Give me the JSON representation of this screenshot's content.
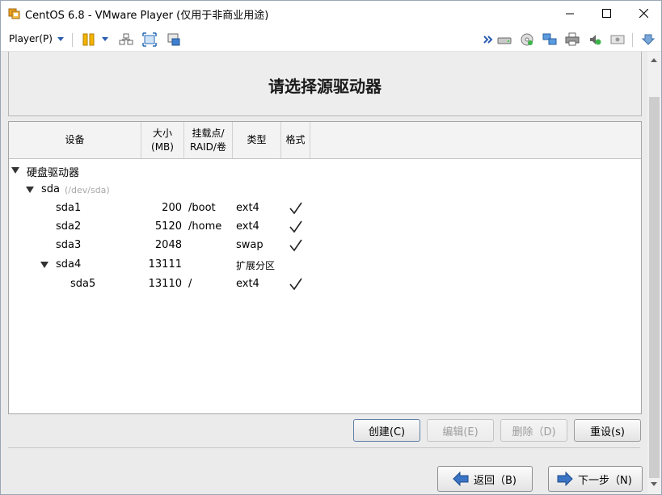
{
  "window": {
    "title": "CentOS 6.8 - VMware Player (仅用于非商业用途)"
  },
  "toolbar": {
    "player_menu": "Player(P)",
    "icons_left": [
      "pause-icon",
      "send-ctrl-alt-del-icon",
      "fullscreen-icon",
      "unity-icon"
    ],
    "icons_right": [
      "more-devices-icon",
      "hard-disk-icon",
      "cd-dvd-icon",
      "network-adapter-icon",
      "printer-icon",
      "sound-card-icon",
      "display-icon",
      "message-log-icon"
    ]
  },
  "installer": {
    "header_title": "请选择源驱动器",
    "columns": {
      "device": "设备",
      "size": "大小\n(MB)",
      "mount": "挂载点/\nRAID/卷",
      "type": "类型",
      "format": "格式"
    },
    "tree": {
      "group_label": "硬盘驱动器",
      "disk": {
        "name": "sda",
        "path": "(/dev/sda)"
      },
      "partitions": [
        {
          "device": "sda1",
          "size": "200",
          "mount": "/boot",
          "type": "ext4",
          "format": true
        },
        {
          "device": "sda2",
          "size": "5120",
          "mount": "/home",
          "type": "ext4",
          "format": true
        },
        {
          "device": "sda3",
          "size": "2048",
          "mount": "",
          "type": "swap",
          "format": true
        },
        {
          "device": "sda4",
          "size": "13111",
          "mount": "",
          "type": "扩展分区",
          "format": false
        },
        {
          "device": "sda5",
          "size": "13110",
          "mount": "/",
          "type": "ext4",
          "format": true
        }
      ]
    },
    "actions": {
      "create": "创建(C)",
      "edit": "编辑(E)",
      "delete": "删除（D)",
      "reset": "重设(s)"
    },
    "nav": {
      "back": "返回（B)",
      "next": "下一步（N)"
    }
  }
}
